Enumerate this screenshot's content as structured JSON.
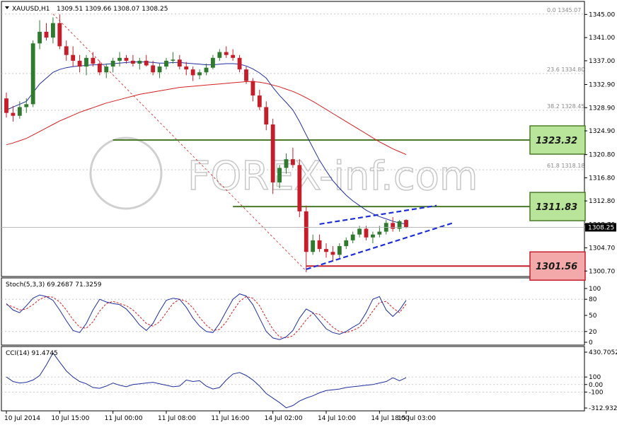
{
  "header": {
    "symbol": "XAUUSD,H1",
    "ohlc": "1309.51 1309.66 1308.07 1308.25"
  },
  "watermark": "FOREX-inf.com",
  "price_axis": {
    "ticks": [
      "1345.00",
      "1341.00",
      "1337.00",
      "1332.90",
      "1328.90",
      "1324.90",
      "1320.80",
      "1316.80",
      "1312.80",
      "1308.70",
      "1304.70",
      "1300.70"
    ],
    "current_price": "1308.25"
  },
  "fib_levels": [
    {
      "label": "0.0  1345.07",
      "value": 1345.07
    },
    {
      "label": "23.6  1334.80",
      "value": 1334.8
    },
    {
      "label": "38.2  1328.45",
      "value": 1328.45
    },
    {
      "label": "61.8  1318.18",
      "value": 1318.18
    }
  ],
  "levels": [
    {
      "label": "1323.32",
      "value": 1323.32,
      "kind": "resistance",
      "color": "#b9e59a"
    },
    {
      "label": "1311.83",
      "value": 1311.83,
      "kind": "resistance",
      "color": "#b9e59a"
    },
    {
      "label": "1301.56",
      "value": 1301.56,
      "kind": "support",
      "color": "#f3a9a9"
    }
  ],
  "stoch": {
    "label": "Stoch(5,3,3) 69.2687 71.3259",
    "ticks": [
      "100",
      "80",
      "50",
      "20",
      "0"
    ]
  },
  "cci": {
    "label": "CCI(14) 91.4745",
    "ticks": [
      "430.7052",
      "100",
      "0.00",
      "-100",
      "-312.9329"
    ]
  },
  "time_axis": [
    "10 Jul 2014",
    "10 Jul 15:00",
    "11 Jul 00:00",
    "11 Jul 08:00",
    "11 Jul 16:00",
    "14 Jul 02:00",
    "14 Jul 10:00",
    "14 Jul 18:00",
    "15 Jul 03:00"
  ],
  "colors": {
    "bull": "#2f7a2f",
    "bear": "#c41e2a",
    "ma_fast": "#1f2f9e",
    "ma_slow": "#d42020",
    "channel": "#1d2fd6",
    "level_line": "#4a7a2a"
  },
  "chart_data": [
    {
      "type": "candlestick",
      "title": "XAUUSD,H1",
      "ylim": [
        1300.0,
        1347.0
      ],
      "candles": [
        [
          1330.5,
          1331.5,
          1327.2,
          1328.0
        ],
        [
          1328.0,
          1329.2,
          1326.5,
          1327.5
        ],
        [
          1327.5,
          1330.0,
          1327.0,
          1329.0
        ],
        [
          1329.0,
          1330.5,
          1328.0,
          1329.5
        ],
        [
          1329.5,
          1340.5,
          1329.0,
          1340.0
        ],
        [
          1340.0,
          1344.0,
          1339.0,
          1342.0
        ],
        [
          1342.0,
          1343.5,
          1340.5,
          1341.0
        ],
        [
          1341.0,
          1344.5,
          1340.0,
          1343.5
        ],
        [
          1343.5,
          1345.0,
          1339.0,
          1339.5
        ],
        [
          1339.5,
          1340.5,
          1337.0,
          1338.0
        ],
        [
          1338.0,
          1339.5,
          1336.0,
          1337.0
        ],
        [
          1337.0,
          1338.0,
          1335.0,
          1336.0
        ],
        [
          1336.0,
          1338.0,
          1334.5,
          1337.5
        ],
        [
          1337.5,
          1338.5,
          1336.0,
          1336.5
        ],
        [
          1336.5,
          1337.0,
          1334.5,
          1335.0
        ],
        [
          1335.0,
          1336.5,
          1334.0,
          1336.0
        ],
        [
          1336.0,
          1337.5,
          1335.0,
          1337.0
        ],
        [
          1337.0,
          1338.5,
          1336.0,
          1337.5
        ],
        [
          1337.5,
          1338.0,
          1336.5,
          1337.0
        ],
        [
          1337.0,
          1338.0,
          1336.0,
          1336.5
        ],
        [
          1336.5,
          1337.5,
          1335.5,
          1337.0
        ],
        [
          1337.0,
          1338.0,
          1336.0,
          1336.2
        ],
        [
          1336.2,
          1337.0,
          1334.5,
          1335.0
        ],
        [
          1335.0,
          1336.5,
          1334.0,
          1336.0
        ],
        [
          1336.0,
          1337.5,
          1335.5,
          1337.0
        ],
        [
          1337.0,
          1338.5,
          1336.5,
          1337.2
        ],
        [
          1337.2,
          1338.0,
          1335.5,
          1336.0
        ],
        [
          1336.0,
          1336.8,
          1334.5,
          1335.5
        ],
        [
          1335.5,
          1336.0,
          1333.5,
          1334.5
        ],
        [
          1334.5,
          1335.5,
          1333.8,
          1335.0
        ],
        [
          1335.0,
          1336.5,
          1334.5,
          1335.8
        ],
        [
          1335.8,
          1338.0,
          1335.5,
          1337.5
        ],
        [
          1337.5,
          1339.0,
          1337.0,
          1338.5
        ],
        [
          1338.5,
          1339.5,
          1337.5,
          1338.0
        ],
        [
          1338.0,
          1339.0,
          1337.0,
          1337.5
        ],
        [
          1337.5,
          1338.0,
          1335.0,
          1335.5
        ],
        [
          1335.5,
          1336.0,
          1333.0,
          1333.5
        ],
        [
          1333.5,
          1334.0,
          1330.0,
          1331.0
        ],
        [
          1331.0,
          1332.0,
          1328.5,
          1329.0
        ],
        [
          1329.0,
          1330.0,
          1325.0,
          1326.0
        ],
        [
          1326.0,
          1327.0,
          1314.0,
          1316.0
        ],
        [
          1316.0,
          1319.0,
          1315.0,
          1318.5
        ],
        [
          1318.5,
          1321.0,
          1317.5,
          1320.0
        ],
        [
          1320.0,
          1322.0,
          1318.5,
          1319.0
        ],
        [
          1319.0,
          1320.0,
          1310.0,
          1311.0
        ],
        [
          1311.0,
          1312.0,
          1300.5,
          1304.0
        ],
        [
          1304.0,
          1307.0,
          1303.5,
          1306.0
        ],
        [
          1306.0,
          1307.0,
          1304.0,
          1304.5
        ],
        [
          1304.5,
          1305.5,
          1303.0,
          1304.0
        ],
        [
          1304.0,
          1305.0,
          1302.5,
          1303.5
        ],
        [
          1303.5,
          1305.5,
          1303.0,
          1305.0
        ],
        [
          1305.0,
          1306.5,
          1304.5,
          1306.0
        ],
        [
          1306.0,
          1307.5,
          1305.5,
          1307.0
        ],
        [
          1307.0,
          1308.5,
          1306.5,
          1308.0
        ],
        [
          1308.0,
          1308.5,
          1306.0,
          1306.5
        ],
        [
          1306.5,
          1307.5,
          1305.5,
          1307.0
        ],
        [
          1307.0,
          1308.5,
          1306.5,
          1307.5
        ],
        [
          1307.5,
          1309.5,
          1307.0,
          1309.0
        ],
        [
          1309.0,
          1310.0,
          1307.5,
          1308.0
        ],
        [
          1308.0,
          1309.5,
          1307.5,
          1309.3
        ],
        [
          1309.51,
          1309.66,
          1308.07,
          1308.25
        ]
      ],
      "ma_fast": [
        1328.5,
        1329.0,
        1329.5,
        1330.0,
        1331.5,
        1333.0,
        1334.0,
        1335.0,
        1335.5,
        1335.8,
        1336.0,
        1336.1,
        1336.2,
        1336.3,
        1336.3,
        1336.4,
        1336.5,
        1336.6,
        1336.7,
        1336.8,
        1336.8,
        1336.8,
        1336.7,
        1336.6,
        1336.6,
        1336.7,
        1336.7,
        1336.6,
        1336.5,
        1336.4,
        1336.3,
        1336.3,
        1336.4,
        1336.5,
        1336.5,
        1336.4,
        1336.1,
        1335.6,
        1334.9,
        1334.0,
        1332.4,
        1331.0,
        1329.8,
        1328.5,
        1326.5,
        1324.2,
        1322.0,
        1319.8,
        1318.0,
        1316.3,
        1315.0,
        1313.8,
        1312.8,
        1312.0,
        1311.2,
        1310.6,
        1310.1,
        1309.7,
        1309.3,
        1309.0,
        1308.8
      ],
      "ma_slow": [
        1322.5,
        1322.8,
        1323.2,
        1323.6,
        1324.2,
        1324.8,
        1325.4,
        1326.0,
        1326.6,
        1327.1,
        1327.6,
        1328.1,
        1328.5,
        1328.9,
        1329.3,
        1329.7,
        1330.0,
        1330.3,
        1330.6,
        1330.9,
        1331.2,
        1331.4,
        1331.6,
        1331.8,
        1332.0,
        1332.2,
        1332.4,
        1332.5,
        1332.6,
        1332.7,
        1332.8,
        1332.9,
        1333.0,
        1333.1,
        1333.2,
        1333.3,
        1333.4,
        1333.4,
        1333.3,
        1333.1,
        1332.8,
        1332.5,
        1332.1,
        1331.7,
        1331.2,
        1330.6,
        1330.0,
        1329.3,
        1328.6,
        1327.9,
        1327.2,
        1326.5,
        1325.8,
        1325.1,
        1324.4,
        1323.7,
        1323.0,
        1322.4,
        1321.8,
        1321.3,
        1320.8
      ]
    },
    {
      "type": "line",
      "title": "Stoch(5,3,3) 69.2687 71.3259",
      "ylim": [
        0,
        100
      ],
      "series": [
        {
          "name": "main",
          "values": [
            72,
            60,
            55,
            68,
            82,
            88,
            85,
            78,
            60,
            40,
            22,
            18,
            35,
            60,
            80,
            75,
            72,
            70,
            62,
            48,
            32,
            22,
            35,
            58,
            78,
            82,
            80,
            65,
            45,
            30,
            20,
            18,
            35,
            58,
            80,
            90,
            86,
            70,
            45,
            20,
            8,
            5,
            10,
            22,
            45,
            62,
            55,
            40,
            25,
            18,
            15,
            20,
            28,
            35,
            55,
            80,
            85,
            60,
            48,
            60,
            78
          ]
        },
        {
          "name": "signal",
          "values": [
            70,
            66,
            60,
            62,
            70,
            80,
            85,
            84,
            75,
            60,
            42,
            28,
            26,
            38,
            58,
            72,
            76,
            72,
            68,
            60,
            48,
            35,
            30,
            38,
            55,
            72,
            80,
            76,
            64,
            46,
            32,
            22,
            24,
            38,
            58,
            76,
            85,
            82,
            68,
            45,
            24,
            10,
            8,
            12,
            25,
            42,
            54,
            52,
            40,
            28,
            20,
            18,
            22,
            28,
            40,
            58,
            74,
            76,
            64,
            55,
            71
          ]
        }
      ]
    },
    {
      "type": "line",
      "title": "CCI(14) 91.4745",
      "ylim": [
        -312.9329,
        430.7052
      ],
      "series": [
        {
          "name": "CCI",
          "values": [
            100,
            40,
            20,
            30,
            60,
            120,
            260,
            420,
            300,
            180,
            100,
            40,
            10,
            -40,
            -50,
            -20,
            20,
            -10,
            -30,
            0,
            10,
            20,
            30,
            10,
            -10,
            -30,
            -20,
            60,
            40,
            50,
            -20,
            -60,
            -40,
            60,
            140,
            160,
            120,
            60,
            -20,
            -120,
            -180,
            -240,
            -310,
            -280,
            -220,
            -180,
            -150,
            -110,
            -80,
            -70,
            -60,
            -40,
            -30,
            -20,
            -10,
            0,
            20,
            40,
            90,
            50,
            91
          ]
        }
      ]
    }
  ]
}
